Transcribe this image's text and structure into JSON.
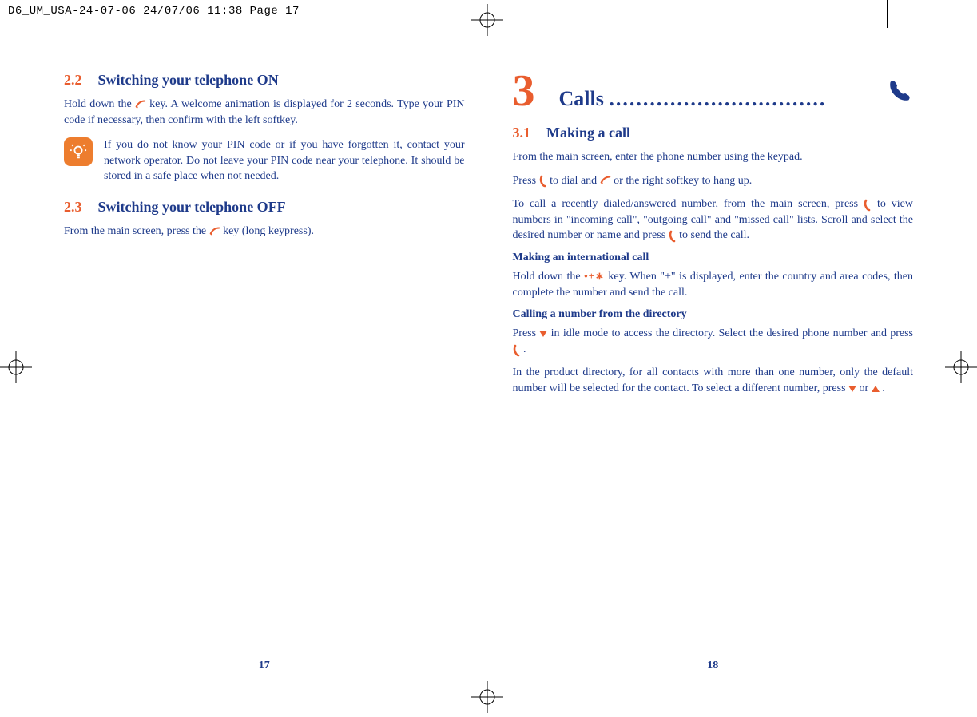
{
  "cropHeader": "D6_UM_USA-24-07-06  24/07/06  11:38  Page 17",
  "left": {
    "sec22_num": "2.2",
    "sec22_title": "Switching your telephone ON",
    "p22_a": "Hold down the ",
    "p22_b": " key. A welcome animation is displayed for 2 seconds. Type your PIN code if necessary, then confirm with the left softkey.",
    "tip": "If you do not know your PIN code or if you have forgotten it, contact your network operator. Do not leave your PIN code near your telephone. It should be stored in a safe place when not needed.",
    "sec23_num": "2.3",
    "sec23_title": "Switching your telephone OFF",
    "p23_a": "From the main screen, press the ",
    "p23_b": " key (long keypress).",
    "pageNum": "17"
  },
  "right": {
    "chapterNum": "3",
    "chapterTitle": "Calls ",
    "chapterDots": "................................",
    "sec31_num": "3.1",
    "sec31_title": "Making a call",
    "p1": "From the main screen, enter the phone number using the keypad.",
    "p2_a": "Press ",
    "p2_b": " to dial and ",
    "p2_c": " or the right softkey to hang up.",
    "p3_a": "To call a recently dialed/answered number, from the main screen, press ",
    "p3_b": " to view numbers in \"incoming call\", \"outgoing call\" and \"missed call\" lists. Scroll and select the desired number or name and press ",
    "p3_c": " to send the call.",
    "h_intl": "Making an international call",
    "p4_a": "Hold down the ",
    "p4_b": " key. When \"+\" is displayed, enter the country and area codes, then complete the number and send the call.",
    "h_dir": "Calling a number from the directory",
    "p5_a": "Press ",
    "p5_b": " in idle mode to access the directory. Select the desired phone number and press ",
    "p5_c": ".",
    "p6_a": "In the product directory, for all contacts with more than one number, only the default number will be selected for the contact. To select a different number, press ",
    "p6_or": " or ",
    "p6_end": ".",
    "pageNum": "18"
  }
}
